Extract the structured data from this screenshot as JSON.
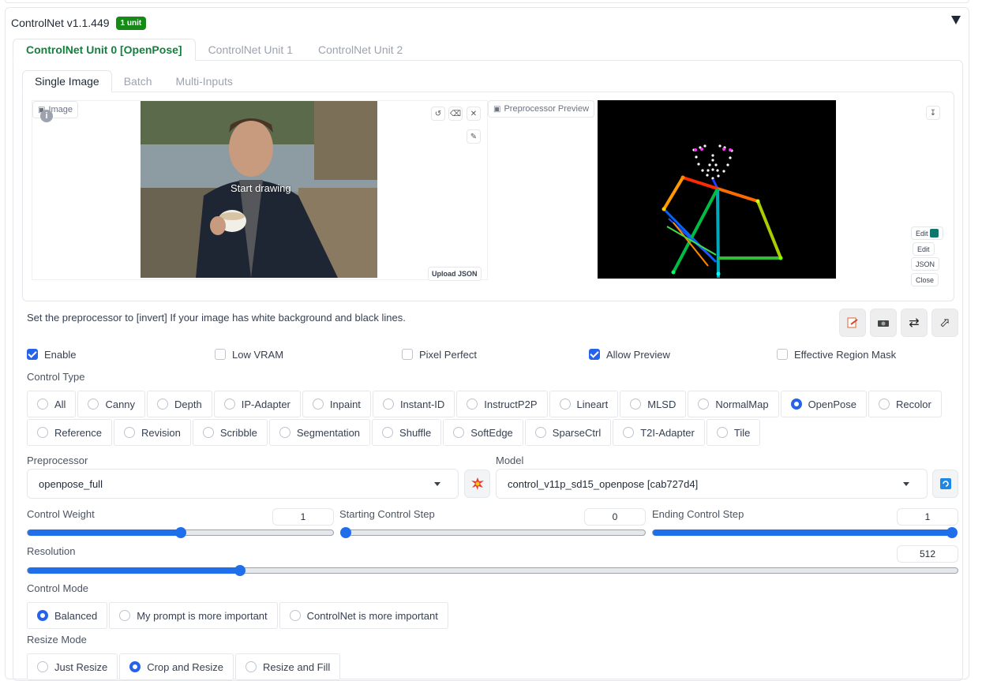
{
  "header": {
    "title": "ControlNet v1.1.449",
    "badge": "1 unit"
  },
  "unit_tabs": [
    "ControlNet Unit 0 [OpenPose]",
    "ControlNet Unit 1",
    "ControlNet Unit 2"
  ],
  "mode_tabs": [
    "Single Image",
    "Batch",
    "Multi-Inputs"
  ],
  "image_panel": {
    "label": "Image",
    "overlay_text": "Start drawing",
    "upload_json": "Upload JSON",
    "preview_label": "Preprocessor Preview",
    "side_buttons": [
      "Edit",
      "Edit",
      "JSON",
      "Close"
    ]
  },
  "hint": "Set the preprocessor to [invert] If your image has white background and black lines.",
  "checkboxes": [
    {
      "label": "Enable",
      "checked": true
    },
    {
      "label": "Low VRAM",
      "checked": false
    },
    {
      "label": "Pixel Perfect",
      "checked": false
    },
    {
      "label": "Allow Preview",
      "checked": true
    },
    {
      "label": "Effective Region Mask",
      "checked": false
    }
  ],
  "control_type": {
    "label": "Control Type",
    "row1": [
      "All",
      "Canny",
      "Depth",
      "IP-Adapter",
      "Inpaint",
      "Instant-ID",
      "InstructP2P",
      "Lineart",
      "MLSD",
      "NormalMap",
      "OpenPose",
      "Recolor"
    ],
    "row2": [
      "Reference",
      "Revision",
      "Scribble",
      "Segmentation",
      "Shuffle",
      "SoftEdge",
      "SparseCtrl",
      "T2I-Adapter",
      "Tile"
    ],
    "selected": "OpenPose"
  },
  "preprocessor": {
    "label": "Preprocessor",
    "value": "openpose_full"
  },
  "model": {
    "label": "Model",
    "value": "control_v11p_sd15_openpose [cab727d4]"
  },
  "sliders": {
    "control_weight": {
      "label": "Control Weight",
      "value": "1",
      "fraction": 0.5
    },
    "starting_step": {
      "label": "Starting Control Step",
      "value": "0",
      "fraction": 0.0
    },
    "ending_step": {
      "label": "Ending Control Step",
      "value": "1",
      "fraction": 1.0
    },
    "resolution": {
      "label": "Resolution",
      "value": "512",
      "fraction": 0.228
    }
  },
  "control_mode": {
    "label": "Control Mode",
    "options": [
      "Balanced",
      "My prompt is more important",
      "ControlNet is more important"
    ],
    "selected": "Balanced"
  },
  "resize_mode": {
    "label": "Resize Mode",
    "options": [
      "Just Resize",
      "Crop and Resize",
      "Resize and Fill"
    ],
    "selected": "Crop and Resize"
  },
  "colors": {
    "accent": "#2563eb",
    "badge": "#168a16",
    "active_tab": "#15803d"
  }
}
